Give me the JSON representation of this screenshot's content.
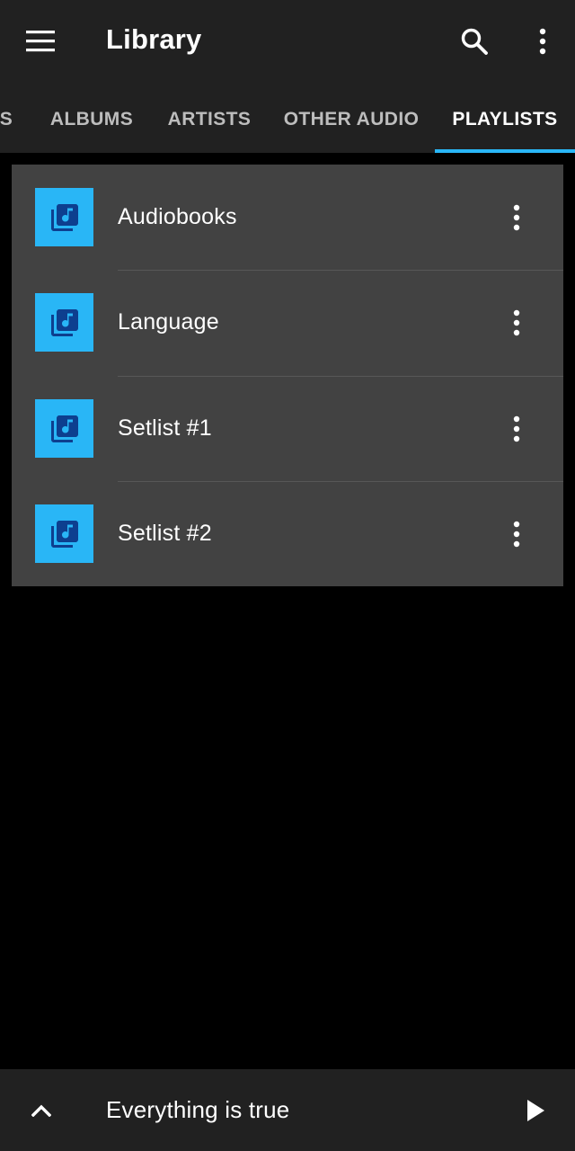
{
  "appbar": {
    "title": "Library",
    "icons": {
      "menu": "menu-icon",
      "search": "search-icon",
      "more": "more-vertical-icon"
    }
  },
  "tabs": [
    {
      "label": "S"
    },
    {
      "label": "ALBUMS"
    },
    {
      "label": "ARTISTS"
    },
    {
      "label": "OTHER AUDIO"
    },
    {
      "label": "PLAYLISTS",
      "active": true
    }
  ],
  "playlists": [
    {
      "name": "Audiobooks"
    },
    {
      "name": "Language"
    },
    {
      "name": "Setlist #1"
    },
    {
      "name": "Setlist #2"
    }
  ],
  "player": {
    "track_title": "Everything is true",
    "icons": {
      "expand": "chevron-up-icon",
      "play": "play-icon"
    }
  },
  "colors": {
    "accent": "#29b6f6",
    "bar_background": "#212121",
    "card_background": "#424242",
    "page_background": "#000000",
    "thumbnail_glyph": "#0d3f8f"
  }
}
